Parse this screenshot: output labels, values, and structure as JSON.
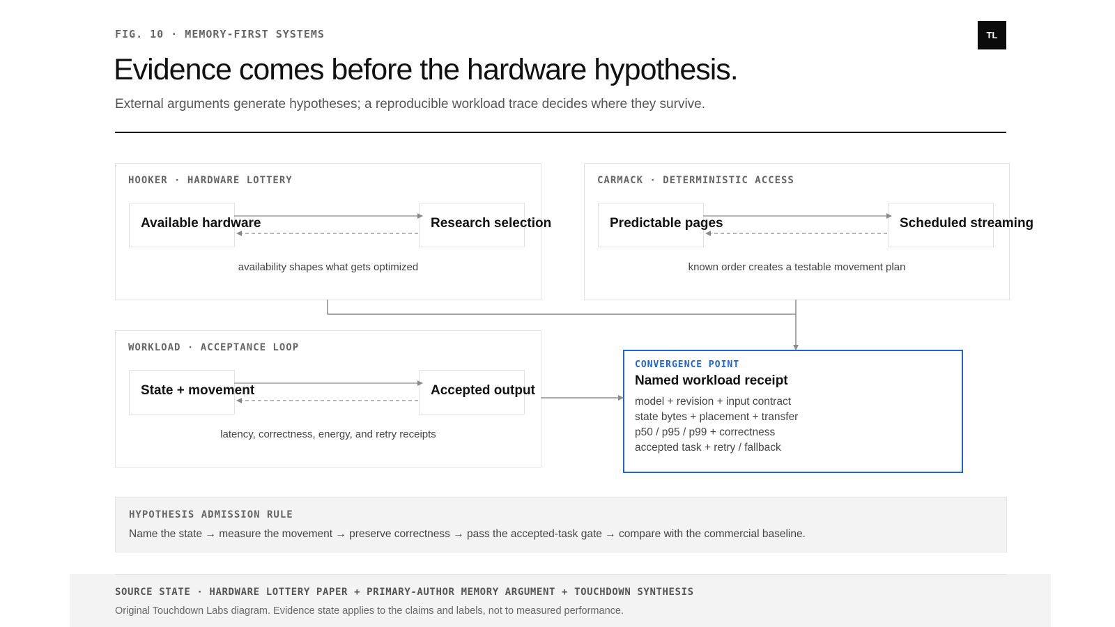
{
  "header": {
    "kicker": "FIG. 10 · MEMORY-FIRST SYSTEMS",
    "logo": "TL",
    "title": "Evidence comes before the hardware hypothesis.",
    "subtitle": "External arguments generate hypotheses; a reproducible workload trace decides where they survive."
  },
  "panels": [
    {
      "label": "HOOKER · HARDWARE LOTTERY",
      "left_node": "Available hardware",
      "right_node": "Research selection",
      "caption": "availability shapes what gets optimized"
    },
    {
      "label": "CARMACK · DETERMINISTIC ACCESS",
      "left_node": "Predictable pages",
      "right_node": "Scheduled streaming",
      "caption": "known order creates a testable movement plan"
    },
    {
      "label": "WORKLOAD · ACCEPTANCE LOOP",
      "left_node": "State + movement",
      "right_node": "Accepted output",
      "caption": "latency, correctness, energy, and retry receipts"
    }
  ],
  "convergence": {
    "kicker": "CONVERGENCE POINT",
    "title": "Named workload receipt",
    "lines": [
      "model + revision + input contract",
      "state bytes + placement + transfer",
      "p50 / p95 / p99 + correctness",
      "accepted task + retry / fallback"
    ]
  },
  "admission_rule": {
    "label": "HYPOTHESIS ADMISSION RULE",
    "text": "Name the state → measure the movement → preserve correctness → pass the accepted-task gate → compare with the commercial baseline."
  },
  "footer": {
    "label": "SOURCE STATE · HARDWARE LOTTERY PAPER + PRIMARY-AUTHOR MEMORY ARGUMENT + TOUCHDOWN SYNTHESIS",
    "text": "Original Touchdown Labs diagram. Evidence state applies to the claims and labels, not to measured performance."
  },
  "colors": {
    "accent": "#1f63d6",
    "ink": "#111111",
    "muted": "#666666",
    "connector": "#8a8a8a"
  }
}
